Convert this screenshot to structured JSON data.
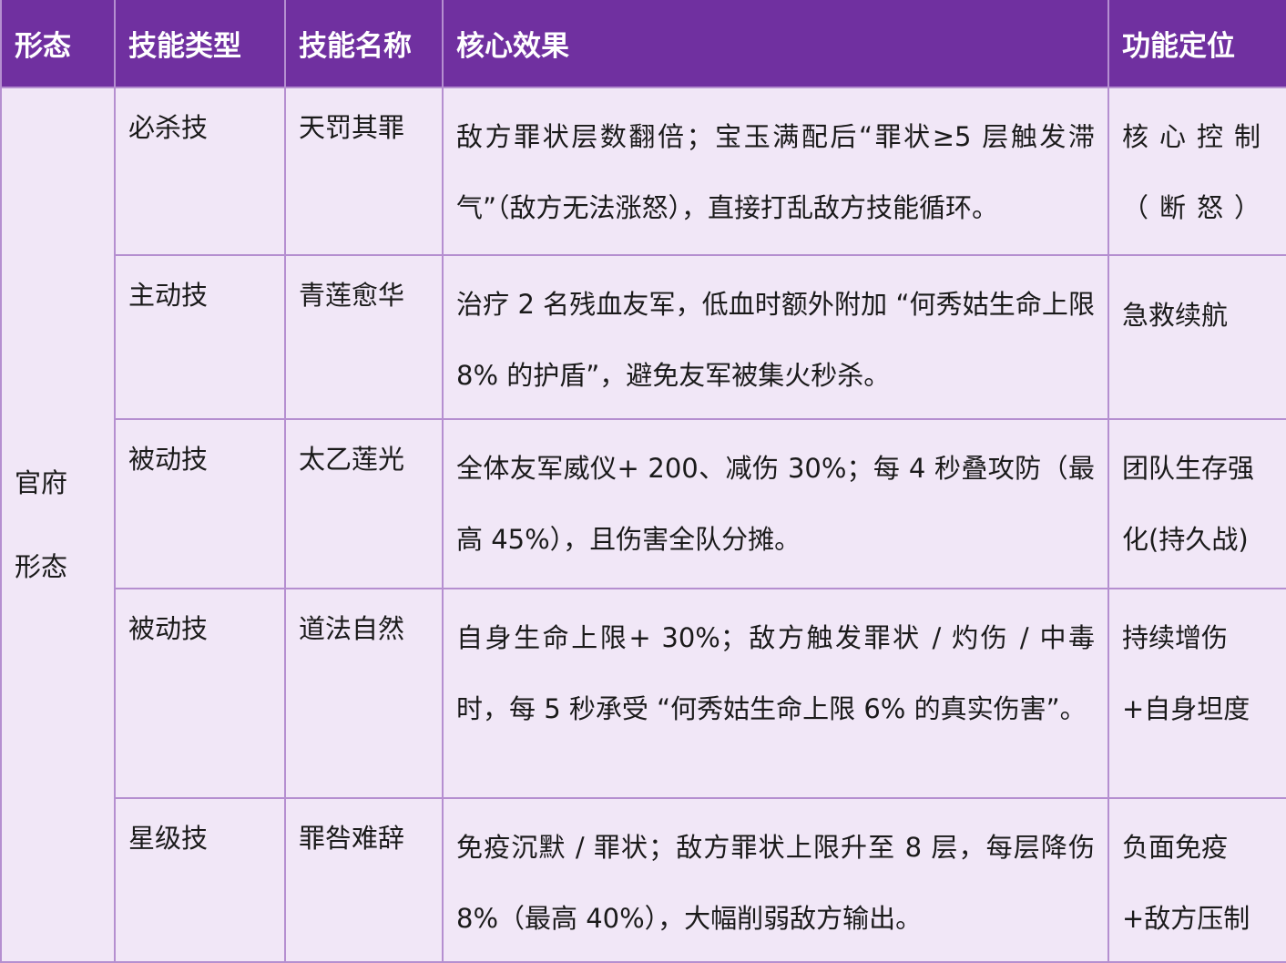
{
  "header": {
    "form": "形态",
    "skill_type": "技能类型",
    "skill_name": "技能名称",
    "core_effect": "核心效果",
    "role": "功能定位"
  },
  "form_cell": {
    "line1": "官府",
    "line2": "形态"
  },
  "rows": [
    {
      "type": "必杀技",
      "name": "天罚其罪",
      "effect": "敌方罪状层数翻倍；宝玉满配后“罪状≥5 层触发滞气”（敌方无法涨怒），直接打乱敌方技能循环。",
      "role": "核心控制（断怒）"
    },
    {
      "type": "主动技",
      "name": "青莲愈华",
      "effect": "治疗 2 名残血友军，低血时额外附加 “何秀姑生命上限 8% 的护盾”，避免友军被集火秒杀。",
      "role": "急救续航"
    },
    {
      "type": "被动技",
      "name": "太乙莲光",
      "effect": "全体友军威仪+ 200、减伤 30%；每 4 秒叠攻防（最高 45%），且伤害全队分摊。",
      "role": "团队生存强化(持久战)"
    },
    {
      "type": "被动技",
      "name": "道法自然",
      "effect": "自身生命上限+ 30%；敌方触发罪状 / 灼伤 / 中毒时，每 5 秒承受 “何秀姑生命上限 6% 的真实伤害”。",
      "role": "持续增伤+自身坦度"
    },
    {
      "type": "星级技",
      "name": "罪咎难辞",
      "effect": "免疫沉默 / 罪状；敌方罪状上限升至 8 层，每层降伤 8%（最高 40%），大幅削弱敌方输出。",
      "role": "负面免疫+敌方压制"
    }
  ]
}
